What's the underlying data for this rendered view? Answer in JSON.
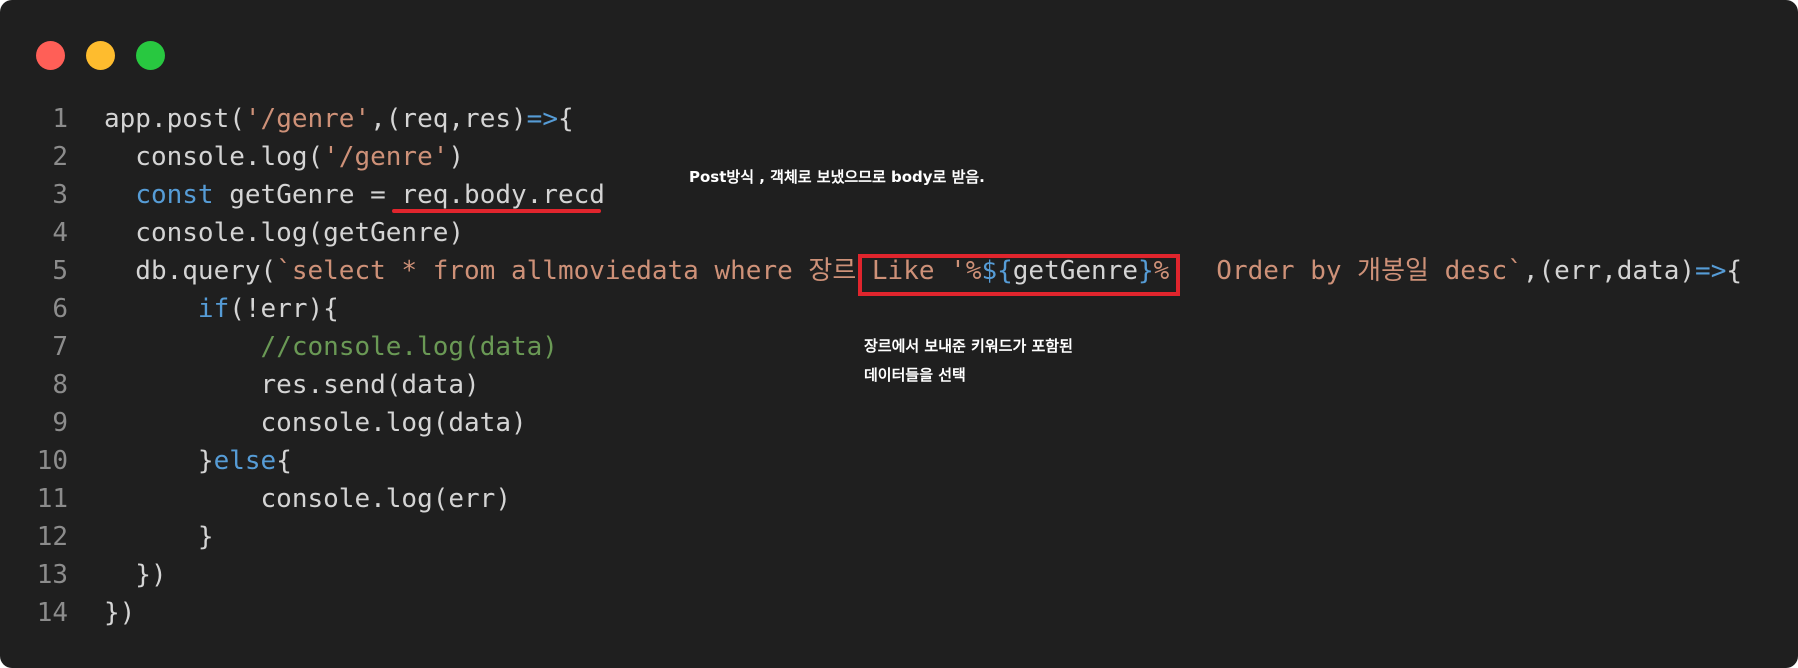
{
  "window": {
    "traffic_lights": [
      "close",
      "minimize",
      "zoom"
    ]
  },
  "code": {
    "lines": [
      {
        "n": "1",
        "tokens": [
          [
            "def",
            "app.post("
          ],
          [
            "str",
            "'/genre'"
          ],
          [
            "def",
            ",(req,res)"
          ],
          [
            "op",
            "=>"
          ],
          [
            "def",
            "{"
          ]
        ]
      },
      {
        "n": "2",
        "tokens": [
          [
            "def",
            "  console.log("
          ],
          [
            "str",
            "'/genre'"
          ],
          [
            "def",
            ")"
          ]
        ]
      },
      {
        "n": "3",
        "tokens": [
          [
            "def",
            "  "
          ],
          [
            "kw",
            "const"
          ],
          [
            "def",
            " getGenre = req.body.recd"
          ]
        ]
      },
      {
        "n": "4",
        "tokens": [
          [
            "def",
            "  console.log(getGenre)"
          ]
        ]
      },
      {
        "n": "5",
        "tokens": [
          [
            "def",
            "  db.query("
          ],
          [
            "str",
            "`select * from allmoviedata where 장르 Like '%"
          ],
          [
            "kw",
            "${"
          ],
          [
            "def",
            "getGenre"
          ],
          [
            "kw",
            "}"
          ],
          [
            "str",
            "%'  Order by 개봉일 desc`"
          ],
          [
            "def",
            ",(err,data)"
          ],
          [
            "op",
            "=>"
          ],
          [
            "def",
            "{"
          ]
        ]
      },
      {
        "n": "6",
        "tokens": [
          [
            "def",
            "      "
          ],
          [
            "kw",
            "if"
          ],
          [
            "def",
            "(!err){"
          ]
        ]
      },
      {
        "n": "7",
        "tokens": [
          [
            "def",
            "          "
          ],
          [
            "cm",
            "//console.log(data)"
          ]
        ]
      },
      {
        "n": "8",
        "tokens": [
          [
            "def",
            "          res.send(data)"
          ]
        ]
      },
      {
        "n": "9",
        "tokens": [
          [
            "def",
            "          console.log(data)"
          ]
        ]
      },
      {
        "n": "10",
        "tokens": [
          [
            "def",
            "      }"
          ],
          [
            "kw",
            "else"
          ],
          [
            "def",
            "{"
          ]
        ]
      },
      {
        "n": "11",
        "tokens": [
          [
            "def",
            "          console.log(err)"
          ]
        ]
      },
      {
        "n": "12",
        "tokens": [
          [
            "def",
            "      }"
          ]
        ]
      },
      {
        "n": "13",
        "tokens": [
          [
            "def",
            "  })"
          ]
        ]
      },
      {
        "n": "14",
        "tokens": [
          [
            "def",
            "})"
          ]
        ]
      }
    ]
  },
  "annotations": {
    "note_post": "Post방식 , 객체로 보냈으므로 body로 받음.",
    "note_like_line1": "장르에서 보내준 키워드가 포함된",
    "note_like_line2": "데이터들을 선택"
  },
  "colors": {
    "background": "#1f1f1f",
    "string": "#ce9178",
    "keyword": "#569cd6",
    "comment": "#6a9955",
    "default": "#d4d4d4",
    "line_number": "#8c8c8c",
    "markup_red": "#e0252d"
  }
}
